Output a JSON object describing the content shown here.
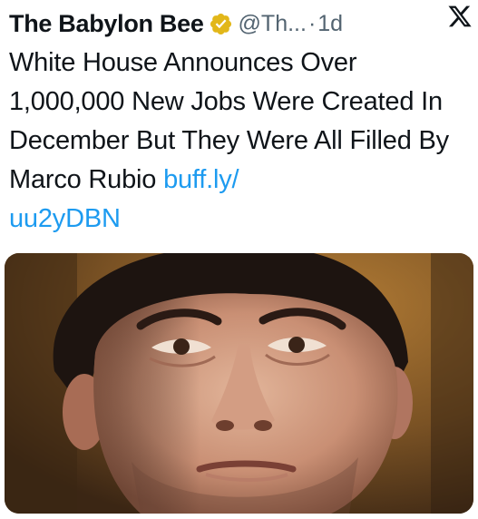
{
  "tweet": {
    "author_name": "The Babylon Bee",
    "handle": "@Th...",
    "separator": "·",
    "time": "1d",
    "text_main": "White House Announces Over 1,000,000 New Jobs Were Created In December But They Were All Filled By Marco Rubio ",
    "link_part1": "buff.ly/",
    "link_part2": "uu2yDBN",
    "media_alt": "Close-up photo of Marco Rubio's face"
  },
  "icons": {
    "verified": "verified-badge-icon",
    "platform": "x-logo-icon"
  },
  "colors": {
    "text": "#0f1419",
    "muted": "#536471",
    "link": "#1d9bf0",
    "verified_gold": "#e2b719"
  }
}
